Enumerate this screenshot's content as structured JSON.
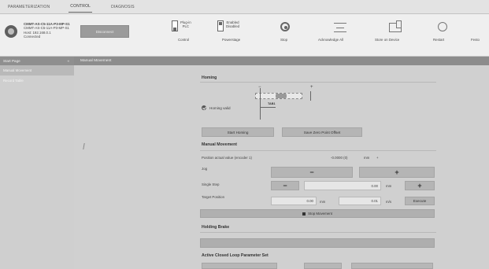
{
  "tabs": [
    {
      "label": "PARAMETERIZATION"
    },
    {
      "label": "CONTROL"
    },
    {
      "label": "DIAGNOSIS"
    }
  ],
  "device": {
    "line1": "CMMT-AS-C5-11A-P3-MP-S1",
    "line2": "CMMT-AS-C5-11A-P3-MP-S1",
    "line3": "Host: 192.168.0.1",
    "line4": "Connected"
  },
  "toolbar": {
    "disconnect_label": "Disconnect",
    "plugin": {
      "line1": "Plug-in",
      "line2": "PLC",
      "label": "Control"
    },
    "enabled": {
      "line1": "Enabled",
      "line2": "Disabled",
      "label": "Powerstage"
    },
    "stop_label": "Stop",
    "ack_label": "Acknowledge All",
    "store_label": "Store on Device",
    "restart_label": "Restart",
    "extra_label": "Festo"
  },
  "left": {
    "header": "Start Page",
    "arrow": "«",
    "items": [
      {
        "label": "Manual Movement"
      },
      {
        "label": "Record Table"
      }
    ]
  },
  "main": {
    "header": "Manual Movement",
    "homing": {
      "title": "Homing",
      "valid_label": "Homing valid",
      "diagram_caption": "TAB1",
      "start_btn": "Start Homing",
      "zero_btn": "Save Zero Point Offset"
    },
    "manual": {
      "title": "Manual Movement",
      "position_label": "Position actual value (encoder 1)",
      "position_value": "-0.0000 (0)",
      "position_unit": "mm",
      "jog_label": "Jog",
      "jog_minus": "−",
      "jog_plus": "+",
      "single_step_label": "Single Step",
      "step_minus": "−",
      "step_value": "0.00",
      "step_unit": "mm",
      "step_plus": "+",
      "target_label": "Target Position",
      "target_value": "0.00",
      "target_unit": "mm",
      "velocity_value": "0.01",
      "velocity_unit": "m/s",
      "execute_btn": "Execute",
      "stop_movement": "Stop Movement"
    },
    "holding": {
      "title": "Holding Brake"
    },
    "active_closed": {
      "title": "Active Closed Loop Parameter Set"
    }
  }
}
